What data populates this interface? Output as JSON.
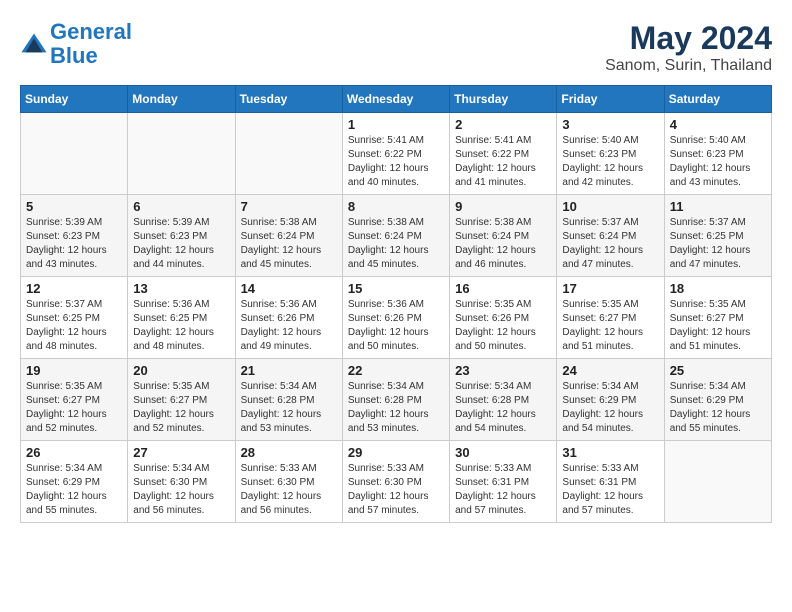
{
  "header": {
    "logo_line1": "General",
    "logo_line2": "Blue",
    "title": "May 2024",
    "subtitle": "Sanom, Surin, Thailand"
  },
  "weekdays": [
    "Sunday",
    "Monday",
    "Tuesday",
    "Wednesday",
    "Thursday",
    "Friday",
    "Saturday"
  ],
  "weeks": [
    [
      {
        "day": "",
        "info": ""
      },
      {
        "day": "",
        "info": ""
      },
      {
        "day": "",
        "info": ""
      },
      {
        "day": "1",
        "info": "Sunrise: 5:41 AM\nSunset: 6:22 PM\nDaylight: 12 hours\nand 40 minutes."
      },
      {
        "day": "2",
        "info": "Sunrise: 5:41 AM\nSunset: 6:22 PM\nDaylight: 12 hours\nand 41 minutes."
      },
      {
        "day": "3",
        "info": "Sunrise: 5:40 AM\nSunset: 6:23 PM\nDaylight: 12 hours\nand 42 minutes."
      },
      {
        "day": "4",
        "info": "Sunrise: 5:40 AM\nSunset: 6:23 PM\nDaylight: 12 hours\nand 43 minutes."
      }
    ],
    [
      {
        "day": "5",
        "info": "Sunrise: 5:39 AM\nSunset: 6:23 PM\nDaylight: 12 hours\nand 43 minutes."
      },
      {
        "day": "6",
        "info": "Sunrise: 5:39 AM\nSunset: 6:23 PM\nDaylight: 12 hours\nand 44 minutes."
      },
      {
        "day": "7",
        "info": "Sunrise: 5:38 AM\nSunset: 6:24 PM\nDaylight: 12 hours\nand 45 minutes."
      },
      {
        "day": "8",
        "info": "Sunrise: 5:38 AM\nSunset: 6:24 PM\nDaylight: 12 hours\nand 45 minutes."
      },
      {
        "day": "9",
        "info": "Sunrise: 5:38 AM\nSunset: 6:24 PM\nDaylight: 12 hours\nand 46 minutes."
      },
      {
        "day": "10",
        "info": "Sunrise: 5:37 AM\nSunset: 6:24 PM\nDaylight: 12 hours\nand 47 minutes."
      },
      {
        "day": "11",
        "info": "Sunrise: 5:37 AM\nSunset: 6:25 PM\nDaylight: 12 hours\nand 47 minutes."
      }
    ],
    [
      {
        "day": "12",
        "info": "Sunrise: 5:37 AM\nSunset: 6:25 PM\nDaylight: 12 hours\nand 48 minutes."
      },
      {
        "day": "13",
        "info": "Sunrise: 5:36 AM\nSunset: 6:25 PM\nDaylight: 12 hours\nand 48 minutes."
      },
      {
        "day": "14",
        "info": "Sunrise: 5:36 AM\nSunset: 6:26 PM\nDaylight: 12 hours\nand 49 minutes."
      },
      {
        "day": "15",
        "info": "Sunrise: 5:36 AM\nSunset: 6:26 PM\nDaylight: 12 hours\nand 50 minutes."
      },
      {
        "day": "16",
        "info": "Sunrise: 5:35 AM\nSunset: 6:26 PM\nDaylight: 12 hours\nand 50 minutes."
      },
      {
        "day": "17",
        "info": "Sunrise: 5:35 AM\nSunset: 6:27 PM\nDaylight: 12 hours\nand 51 minutes."
      },
      {
        "day": "18",
        "info": "Sunrise: 5:35 AM\nSunset: 6:27 PM\nDaylight: 12 hours\nand 51 minutes."
      }
    ],
    [
      {
        "day": "19",
        "info": "Sunrise: 5:35 AM\nSunset: 6:27 PM\nDaylight: 12 hours\nand 52 minutes."
      },
      {
        "day": "20",
        "info": "Sunrise: 5:35 AM\nSunset: 6:27 PM\nDaylight: 12 hours\nand 52 minutes."
      },
      {
        "day": "21",
        "info": "Sunrise: 5:34 AM\nSunset: 6:28 PM\nDaylight: 12 hours\nand 53 minutes."
      },
      {
        "day": "22",
        "info": "Sunrise: 5:34 AM\nSunset: 6:28 PM\nDaylight: 12 hours\nand 53 minutes."
      },
      {
        "day": "23",
        "info": "Sunrise: 5:34 AM\nSunset: 6:28 PM\nDaylight: 12 hours\nand 54 minutes."
      },
      {
        "day": "24",
        "info": "Sunrise: 5:34 AM\nSunset: 6:29 PM\nDaylight: 12 hours\nand 54 minutes."
      },
      {
        "day": "25",
        "info": "Sunrise: 5:34 AM\nSunset: 6:29 PM\nDaylight: 12 hours\nand 55 minutes."
      }
    ],
    [
      {
        "day": "26",
        "info": "Sunrise: 5:34 AM\nSunset: 6:29 PM\nDaylight: 12 hours\nand 55 minutes."
      },
      {
        "day": "27",
        "info": "Sunrise: 5:34 AM\nSunset: 6:30 PM\nDaylight: 12 hours\nand 56 minutes."
      },
      {
        "day": "28",
        "info": "Sunrise: 5:33 AM\nSunset: 6:30 PM\nDaylight: 12 hours\nand 56 minutes."
      },
      {
        "day": "29",
        "info": "Sunrise: 5:33 AM\nSunset: 6:30 PM\nDaylight: 12 hours\nand 57 minutes."
      },
      {
        "day": "30",
        "info": "Sunrise: 5:33 AM\nSunset: 6:31 PM\nDaylight: 12 hours\nand 57 minutes."
      },
      {
        "day": "31",
        "info": "Sunrise: 5:33 AM\nSunset: 6:31 PM\nDaylight: 12 hours\nand 57 minutes."
      },
      {
        "day": "",
        "info": ""
      }
    ]
  ]
}
